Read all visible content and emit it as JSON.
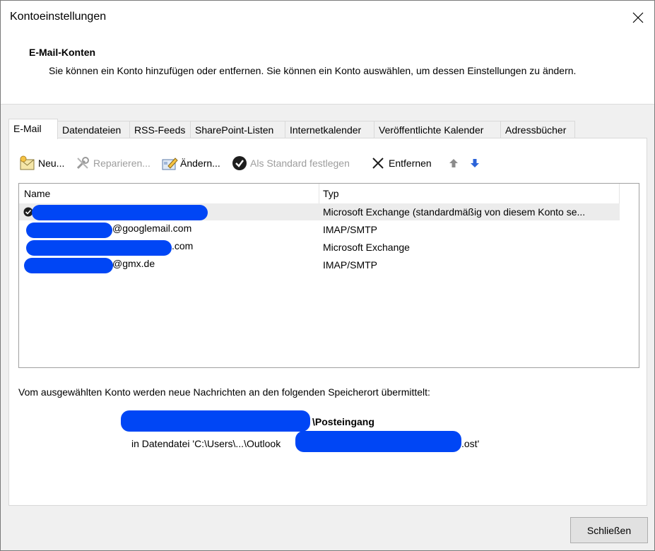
{
  "window": {
    "title": "Kontoeinstellungen"
  },
  "header": {
    "title": "E-Mail-Konten",
    "description": "Sie können ein Konto hinzufügen oder entfernen. Sie können ein Konto auswählen, um dessen Einstellungen zu ändern."
  },
  "tabs": [
    {
      "label": "E-Mail"
    },
    {
      "label": "Datendateien"
    },
    {
      "label": "RSS-Feeds"
    },
    {
      "label": "SharePoint-Listen"
    },
    {
      "label": "Internetkalender"
    },
    {
      "label": "Veröffentlichte Kalender"
    },
    {
      "label": "Adressbücher"
    }
  ],
  "toolbar": {
    "new_label": "Neu...",
    "repair_label": "Reparieren...",
    "change_label": "Ändern...",
    "set_default_label": "Als Standard festlegen",
    "remove_label": "Entfernen"
  },
  "list": {
    "col_name": "Name",
    "col_type": "Typ",
    "rows": [
      {
        "name_suffix": "",
        "type": "Microsoft Exchange (standardmäßig von diesem Konto se..."
      },
      {
        "name_suffix": "@googlemail.com",
        "type": "IMAP/SMTP"
      },
      {
        "name_suffix": ".com",
        "type": "Microsoft Exchange"
      },
      {
        "name_suffix": "@gmx.de",
        "type": "IMAP/SMTP"
      }
    ]
  },
  "delivery": {
    "text": "Vom ausgewählten Konto werden neue Nachrichten an den folgenden Speicherort übermittelt:",
    "folder": "\\Posteingang",
    "datafile_prefix": "in Datendatei 'C:\\Users\\...\\Outlook",
    "datafile_suffix": ".ost'"
  },
  "footer": {
    "close_label": "Schließen"
  },
  "colors": {
    "redaction": "#0046f5",
    "arrow_blue": "#2b63d9",
    "selected_row": "#ececec"
  }
}
